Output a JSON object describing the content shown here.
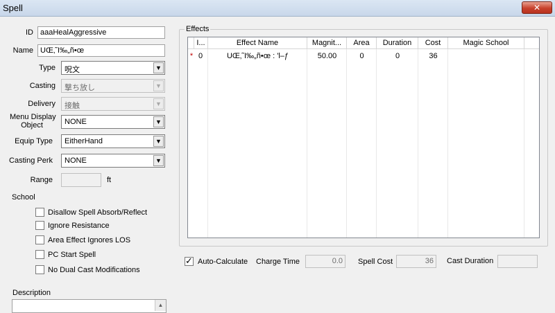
{
  "window": {
    "title": "Spell",
    "close_label": "✕"
  },
  "form": {
    "id_label": "ID",
    "id_value": "aaaHealAggressive",
    "name_label": "Name",
    "name_value": "UŒ‚˜I‰„ñ•œ",
    "type_label": "Type",
    "type_value": "呪文",
    "casting_label": "Casting",
    "casting_value": "撃ち放し",
    "delivery_label": "Delivery",
    "delivery_value": "接触",
    "menu_display_label_line1": "Menu Display",
    "menu_display_label_line2": "Object",
    "menu_display_value": "NONE",
    "equip_type_label": "Equip Type",
    "equip_type_value": "EitherHand",
    "casting_perk_label": "Casting Perk",
    "casting_perk_value": "NONE",
    "range_label": "Range",
    "range_value": "",
    "range_unit": "ft",
    "school_label": "School",
    "description_label": "Description"
  },
  "checkboxes": [
    {
      "label": "Disallow Spell Absorb/Reflect",
      "checked": false
    },
    {
      "label": "Ignore Resistance",
      "checked": false
    },
    {
      "label": "Area Effect Ignores LOS",
      "checked": false
    },
    {
      "label": "PC Start Spell",
      "checked": false
    },
    {
      "label": "No Dual Cast Modifications",
      "checked": false
    }
  ],
  "effects": {
    "group_title": "Effects",
    "columns": [
      "I...",
      "Effect Name",
      "Magnit...",
      "Area",
      "Duration",
      "Cost",
      "Magic School"
    ],
    "rows": [
      {
        "marker": "*",
        "index": "0",
        "effect_name": "UŒ‚˜I‰„ñ•œ : 'l–ƒ",
        "magnitude": "50.00",
        "area": "0",
        "duration": "0",
        "cost": "36",
        "magic_school": ""
      }
    ]
  },
  "footer": {
    "auto_calculate_label": "Auto-Calculate",
    "auto_calculate_checked": true,
    "charge_time_label": "Charge Time",
    "charge_time_value": "0.0",
    "spell_cost_label": "Spell Cost",
    "spell_cost_value": "36",
    "cast_duration_label": "Cast Duration",
    "cast_duration_value": ""
  },
  "icons": {
    "dropdown": "chevron-down-icon",
    "close": "close-icon",
    "check": "checkmark-icon"
  }
}
